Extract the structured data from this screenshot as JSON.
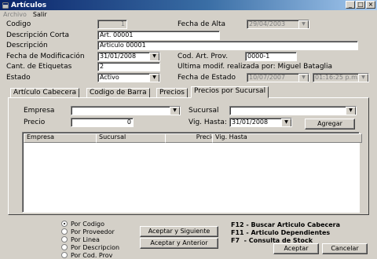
{
  "window": {
    "title": "Artículos",
    "minimize_glyph": "_",
    "maximize_glyph": "□",
    "close_glyph": "×"
  },
  "menu": {
    "items": [
      "Archivo",
      "Salir"
    ]
  },
  "form": {
    "codigo_label": "Codigo",
    "codigo_value": "1",
    "fecha_alta_label": "Fecha de Alta",
    "fecha_alta_value": "29/04/2003",
    "desc_corta_label": "Descripción Corta",
    "desc_corta_value": "Art. 00001",
    "descripcion_label": "Descripción",
    "descripcion_value": "Articulo 00001",
    "fecha_mod_label": "Fecha de Modificación",
    "fecha_mod_value": "31/01/2008",
    "cod_art_prov_label": "Cod. Art. Prov.",
    "cod_art_prov_value": "0000-1",
    "cant_etiquetas_label": "Cant. de Etiquetas",
    "cant_etiquetas_value": "2",
    "ultima_modif_text": "Ultima modif. realizada por: Miguel Bataglia",
    "estado_label": "Estado",
    "estado_value": "Activo",
    "fecha_estado_label": "Fecha de Estado",
    "fecha_estado_value": "10/07/2007",
    "hora_estado_value": "01:16:25 p.m."
  },
  "tabs": [
    "Artículo Cabecera",
    "Codigo de Barra",
    "Precios",
    "Precios por Sucursal"
  ],
  "sucursal_panel": {
    "empresa_label": "Empresa",
    "empresa_value": "",
    "sucursal_label": "Sucursal",
    "sucursal_value": "",
    "precio_label": "Precio",
    "precio_value": "0",
    "vig_hasta_label": "Vig. Hasta:",
    "vig_hasta_value": "31/01/2008",
    "agregar_label": "Agregar",
    "columns": [
      "Empresa",
      "Sucursal",
      "Precio",
      "Vig. Hasta"
    ]
  },
  "search": {
    "options": [
      "Por Codigo",
      "Por Proveedor",
      "Por Linea",
      "Por Descripcion",
      "Por Cod. Prov"
    ],
    "selected_index": 0,
    "next_label": "Aceptar y Siguiente",
    "prev_label": "Aceptar y Anterior"
  },
  "shortcuts": [
    "F12 - Buscar Articulo Cabecera",
    "F11 - Articulo Dependientes",
    "F7  - Consulta de Stock"
  ],
  "buttons": {
    "aceptar": "Aceptar",
    "cancelar": "Cancelar"
  },
  "colors": {
    "face": "#d4d0c8",
    "title_start": "#0a246a",
    "title_end": "#a6caf0"
  },
  "icons": {
    "window": "app-window-icon",
    "dropdown": "chevron-down-icon"
  }
}
